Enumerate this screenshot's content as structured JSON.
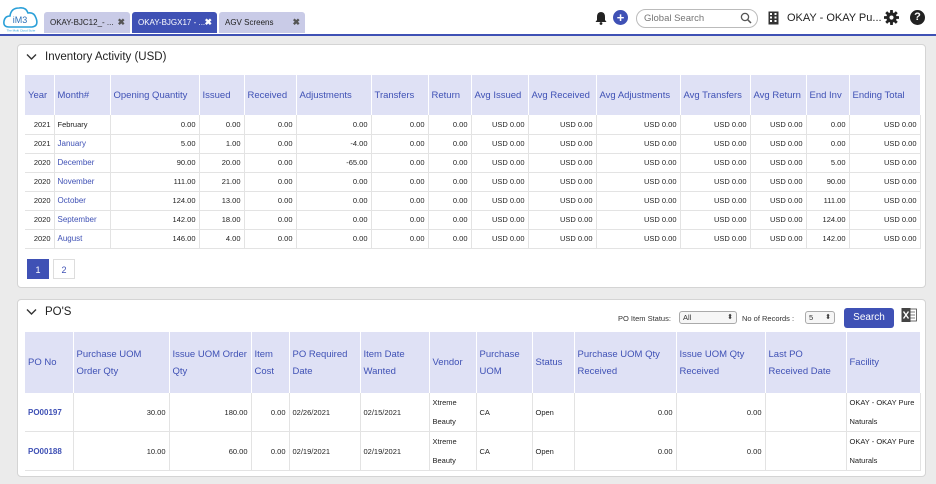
{
  "header": {
    "logo_text": "iM3",
    "logo_tagline": "The Multi Cloud Suite",
    "tabs": [
      {
        "label": "OKAY-BJC12_- ...",
        "close": "✖"
      },
      {
        "label": "OKAY-BJGX17 - ...",
        "close": "✖"
      },
      {
        "label": "AGV Screens",
        "close": "✖"
      }
    ],
    "search_placeholder": "Global Search",
    "company": "OKAY - OKAY Pu...",
    "help": "?"
  },
  "inventory": {
    "title": "Inventory Activity (USD)",
    "columns": [
      "Year",
      "Month#",
      "Opening Quantity",
      "Issued",
      "Received",
      "Adjustments",
      "Transfers",
      "Return",
      "Avg Issued",
      "Avg Received",
      "Avg Adjustments",
      "Avg Transfers",
      "Avg Return",
      "End Inv",
      "Ending Total"
    ],
    "rows": [
      [
        "2021",
        "February",
        "0.00",
        "0.00",
        "0.00",
        "0.00",
        "0.00",
        "0.00",
        "USD 0.00",
        "USD 0.00",
        "USD 0.00",
        "USD 0.00",
        "USD 0.00",
        "0.00",
        "USD 0.00"
      ],
      [
        "2021",
        "January",
        "5.00",
        "1.00",
        "0.00",
        "-4.00",
        "0.00",
        "0.00",
        "USD 0.00",
        "USD 0.00",
        "USD 0.00",
        "USD 0.00",
        "USD 0.00",
        "0.00",
        "USD 0.00"
      ],
      [
        "2020",
        "December",
        "90.00",
        "20.00",
        "0.00",
        "-65.00",
        "0.00",
        "0.00",
        "USD 0.00",
        "USD 0.00",
        "USD 0.00",
        "USD 0.00",
        "USD 0.00",
        "5.00",
        "USD 0.00"
      ],
      [
        "2020",
        "November",
        "111.00",
        "21.00",
        "0.00",
        "0.00",
        "0.00",
        "0.00",
        "USD 0.00",
        "USD 0.00",
        "USD 0.00",
        "USD 0.00",
        "USD 0.00",
        "90.00",
        "USD 0.00"
      ],
      [
        "2020",
        "October",
        "124.00",
        "13.00",
        "0.00",
        "0.00",
        "0.00",
        "0.00",
        "USD 0.00",
        "USD 0.00",
        "USD 0.00",
        "USD 0.00",
        "USD 0.00",
        "111.00",
        "USD 0.00"
      ],
      [
        "2020",
        "September",
        "142.00",
        "18.00",
        "0.00",
        "0.00",
        "0.00",
        "0.00",
        "USD 0.00",
        "USD 0.00",
        "USD 0.00",
        "USD 0.00",
        "USD 0.00",
        "124.00",
        "USD 0.00"
      ],
      [
        "2020",
        "August",
        "146.00",
        "4.00",
        "0.00",
        "0.00",
        "0.00",
        "0.00",
        "USD 0.00",
        "USD 0.00",
        "USD 0.00",
        "USD 0.00",
        "USD 0.00",
        "142.00",
        "USD 0.00"
      ]
    ],
    "pages": [
      "1",
      "2"
    ]
  },
  "pos": {
    "title": "PO'S",
    "status_label": "PO Item Status:",
    "status_value": "All",
    "records_label": "No of Records :",
    "records_value": "5",
    "search_label": "Search",
    "columns": [
      "PO No",
      "Purchase UOM Order Qty",
      "Issue UOM Order Qty",
      "Item Cost",
      "PO Required Date",
      "Item Date Wanted",
      "Vendor",
      "Purchase UOM",
      "Status",
      "Purchase UOM Qty Received",
      "Issue UOM Qty Received",
      "Last PO Received Date",
      "Facility"
    ],
    "rows": [
      [
        "PO00197",
        "30.00",
        "180.00",
        "0.00",
        "02/26/2021",
        "02/15/2021",
        "Xtreme Beauty",
        "CA",
        "Open",
        "0.00",
        "0.00",
        "",
        "OKAY - OKAY Pure Naturals"
      ],
      [
        "PO00188",
        "10.00",
        "60.00",
        "0.00",
        "02/19/2021",
        "02/19/2021",
        "Xtreme Beauty",
        "CA",
        "Open",
        "0.00",
        "0.00",
        "",
        "OKAY - OKAY Pure Naturals"
      ]
    ]
  }
}
